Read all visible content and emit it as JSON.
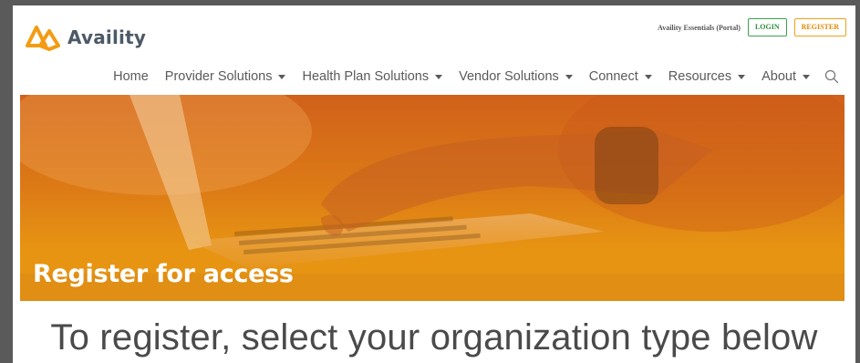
{
  "brand": {
    "name": "Availity",
    "trademark": "·"
  },
  "utility": {
    "portal_link": "Availity Essentials (Portal)",
    "login": "LOGIN",
    "register": "REGISTER"
  },
  "nav": {
    "items": [
      {
        "label": "Home",
        "has_menu": false
      },
      {
        "label": "Provider Solutions",
        "has_menu": true
      },
      {
        "label": "Health Plan Solutions",
        "has_menu": true
      },
      {
        "label": "Vendor Solutions",
        "has_menu": true
      },
      {
        "label": "Connect",
        "has_menu": true
      },
      {
        "label": "Resources",
        "has_menu": true
      },
      {
        "label": "About",
        "has_menu": true
      }
    ],
    "search_icon": "search-icon"
  },
  "hero": {
    "title": "Register for access"
  },
  "main": {
    "subheading": "To register, select your organization type below"
  },
  "colors": {
    "accent_orange": "#f0a11a",
    "accent_green": "#3aa34a",
    "logo_orange": "#f39c12"
  }
}
